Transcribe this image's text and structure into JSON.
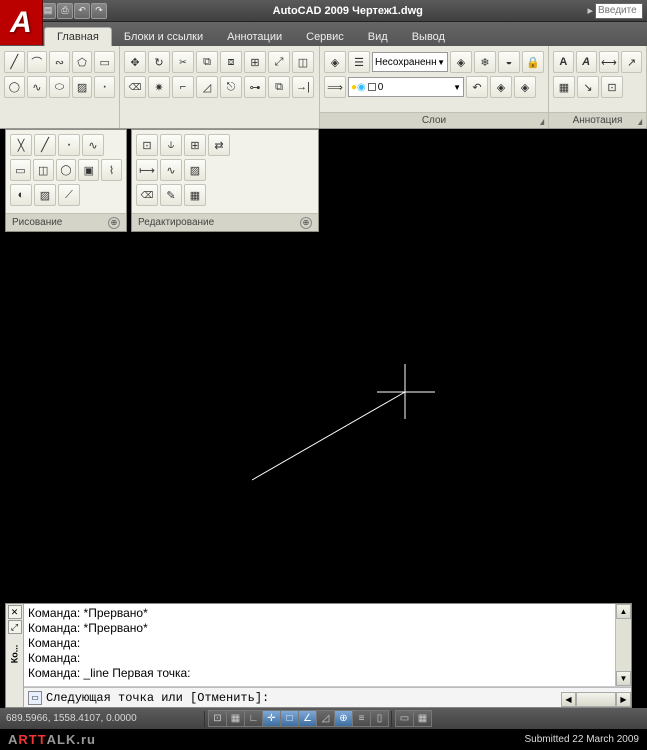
{
  "app": {
    "title": "AutoCAD 2009",
    "doc": "Чертеж1.dwg",
    "search_placeholder": "Введите"
  },
  "tabs": {
    "home": "Главная",
    "blocks": "Блоки и ссылки",
    "anno": "Аннотации",
    "service": "Сервис",
    "view": "Вид",
    "output": "Вывод"
  },
  "panels": {
    "layers_title": "Слои",
    "anno_title": "Аннотация",
    "layer_selected": "Несохраненн",
    "draw": "Рисование",
    "edit": "Редактирование"
  },
  "cmd": {
    "h1": "Команда: *Прервано*",
    "h2": "Команда: *Прервано*",
    "h3": "Команда:",
    "h4": "Команда:",
    "h5": "Команда: _line Первая точка:",
    "prompt": "Следующая точка или [Отменить]:",
    "gutter": "Ко..."
  },
  "status": {
    "coords": "689.5966, 1558.4107, 0.0000"
  },
  "footer": {
    "site_a": "A",
    "site_b": "RTT",
    "site_c": "ALK.ru",
    "submitted": "Submitted 22 March 2009"
  }
}
